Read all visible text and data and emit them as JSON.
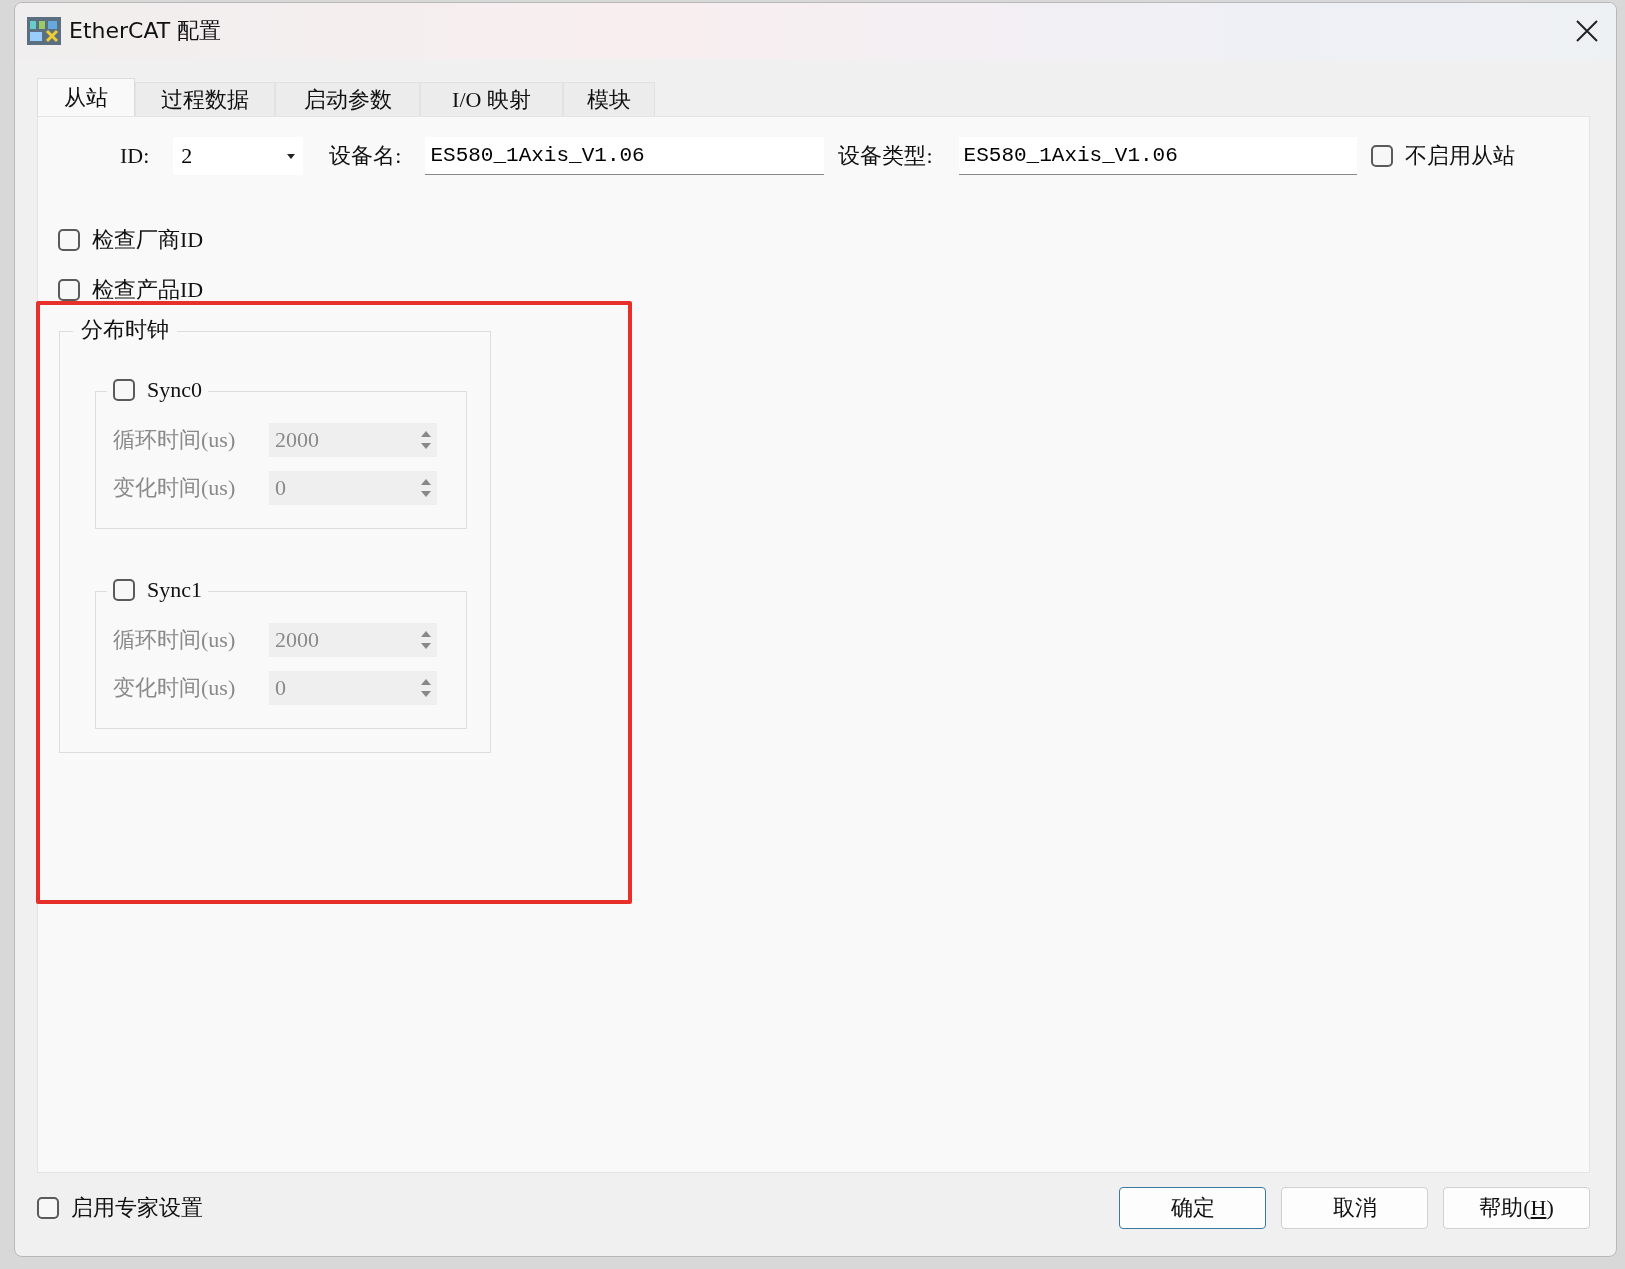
{
  "window": {
    "title": "EtherCAT 配置"
  },
  "tabs": [
    {
      "label": "从站",
      "selected": true
    },
    {
      "label": "过程数据",
      "selected": false
    },
    {
      "label": "启动参数",
      "selected": false
    },
    {
      "label": "I/O 映射",
      "selected": false
    },
    {
      "label": "模块",
      "selected": false
    }
  ],
  "slave": {
    "id_label": "ID:",
    "id_value": "2",
    "name_label": "设备名:",
    "name_value": "ES580_1Axis_V1.06",
    "type_label": "设备类型:",
    "type_value": "ES580_1Axis_V1.06",
    "disable_slave": {
      "label": "不启用从站",
      "checked": false
    }
  },
  "checks": [
    {
      "label": "检查厂商ID",
      "checked": false
    },
    {
      "label": "检查产品ID",
      "checked": false
    }
  ],
  "distributed_clock": {
    "title": "分布时钟",
    "highlighted": true,
    "syncs": [
      {
        "label": "Sync0",
        "checked": false,
        "rows": [
          {
            "label": "循环时间(us)",
            "value": "2000",
            "disabled": true
          },
          {
            "label": "变化时间(us)",
            "value": "0",
            "disabled": true
          }
        ]
      },
      {
        "label": "Sync1",
        "checked": false,
        "rows": [
          {
            "label": "循环时间(us)",
            "value": "2000",
            "disabled": true
          },
          {
            "label": "变化时间(us)",
            "value": "0",
            "disabled": true
          }
        ]
      }
    ]
  },
  "expert": {
    "label": "启用专家设置",
    "checked": false
  },
  "buttons": [
    {
      "label": "确定",
      "kind": "default"
    },
    {
      "label": "取消",
      "kind": "normal"
    },
    {
      "label": "帮助(H)",
      "kind": "accelerator"
    }
  ]
}
